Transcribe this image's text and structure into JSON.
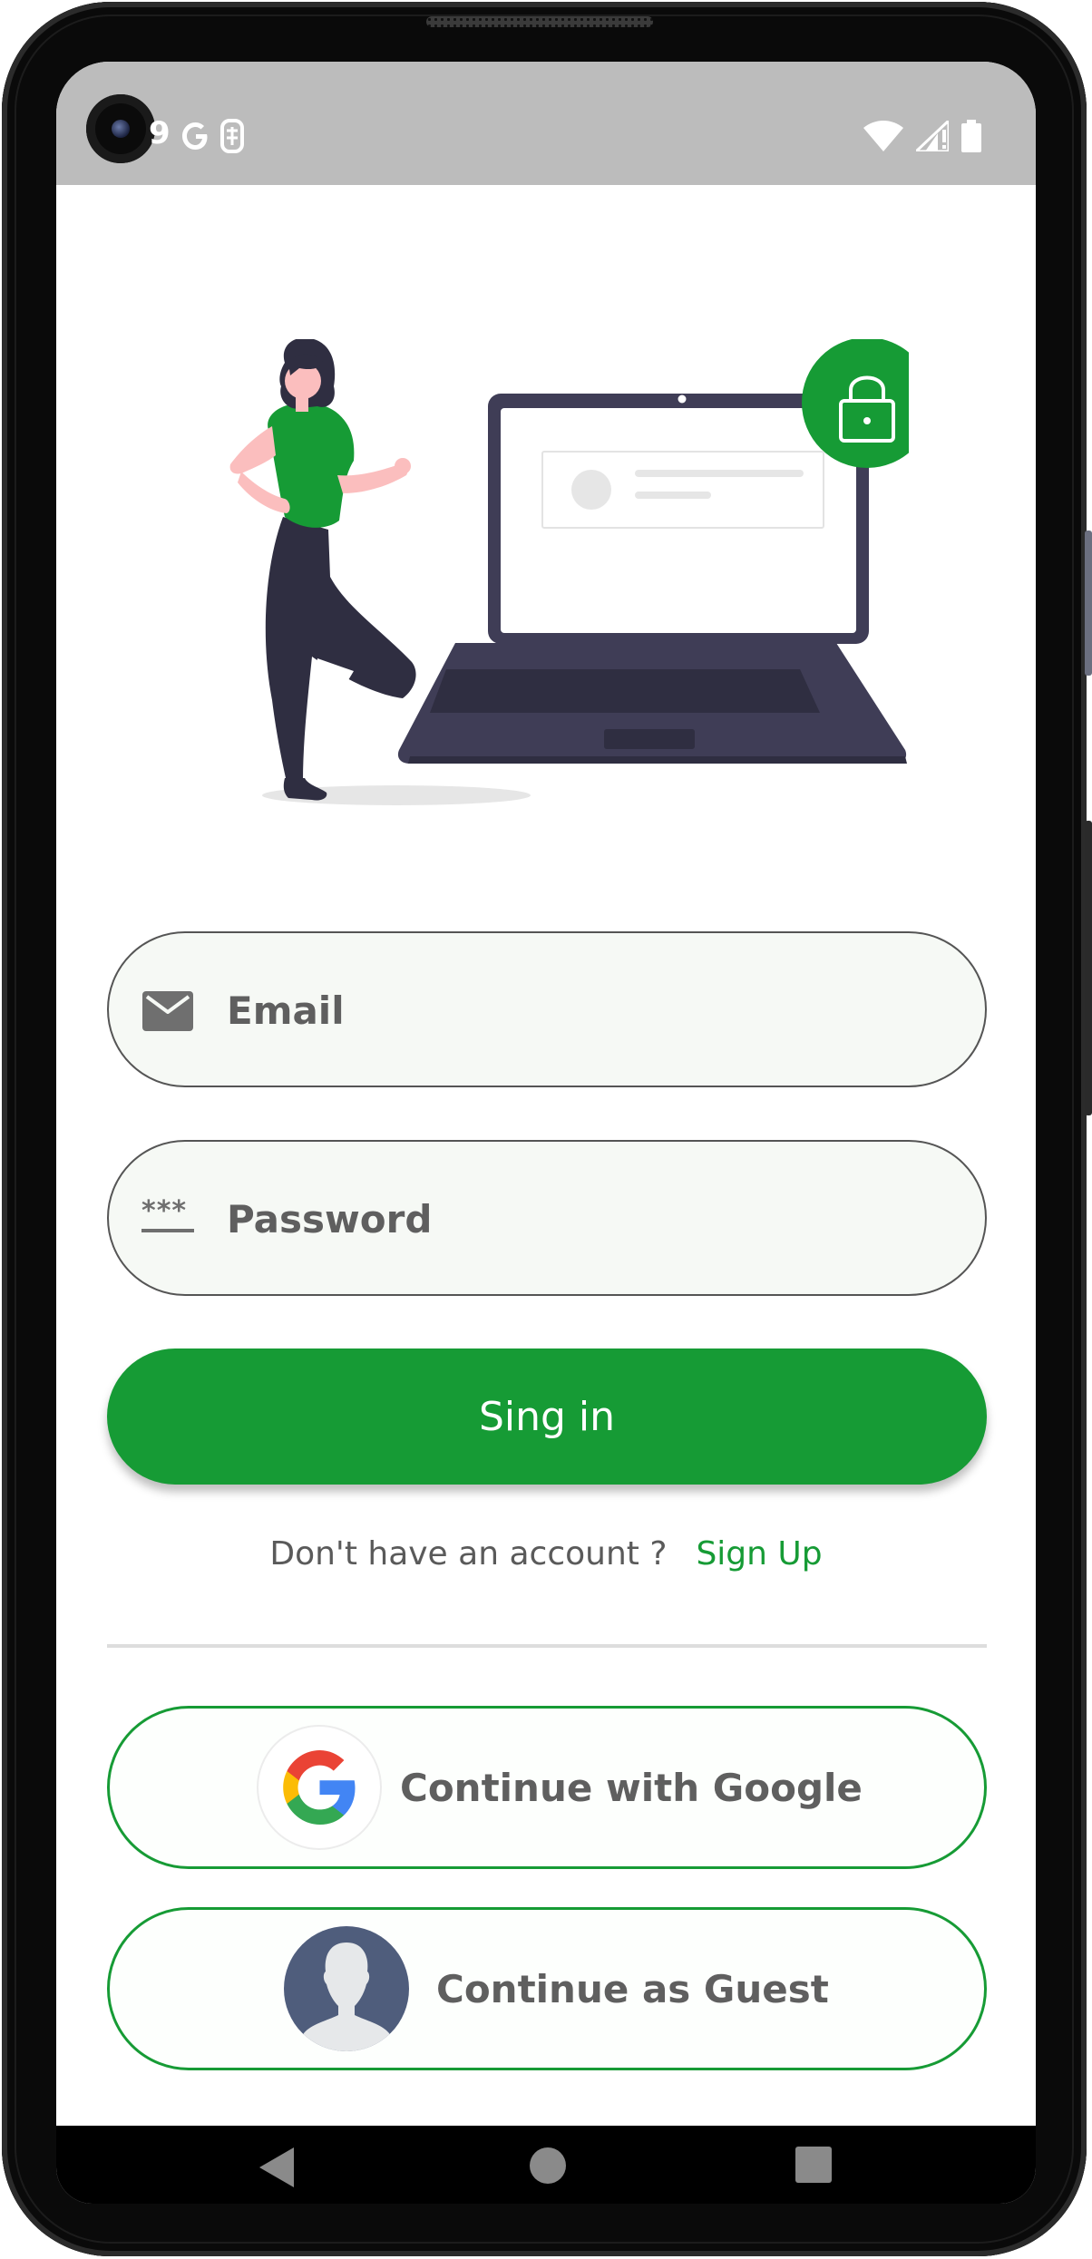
{
  "status_bar": {
    "time_fragment": "9",
    "app_icons": [
      "google-g-icon",
      "sim-icon"
    ],
    "system_icons": [
      "wifi-icon",
      "signal-icon",
      "battery-icon"
    ]
  },
  "login": {
    "email_placeholder": "Email",
    "email_value": "",
    "password_placeholder": "Password",
    "password_value": "",
    "password_icon_text": "***",
    "signin_label": "Sing in",
    "no_account_text": "Don't have an account ?",
    "signup_link": "Sign Up",
    "google_label": "Continue with Google",
    "guest_label": "Continue as Guest"
  },
  "colors": {
    "accent": "#169b35",
    "field_bg": "#f6f9f5",
    "text": "#5f5f5f",
    "status_bar": "#bcbcbc",
    "illustration_dark": "#3f3d56"
  },
  "nav": {
    "icons": [
      "back-icon",
      "home-icon",
      "recents-icon"
    ]
  }
}
